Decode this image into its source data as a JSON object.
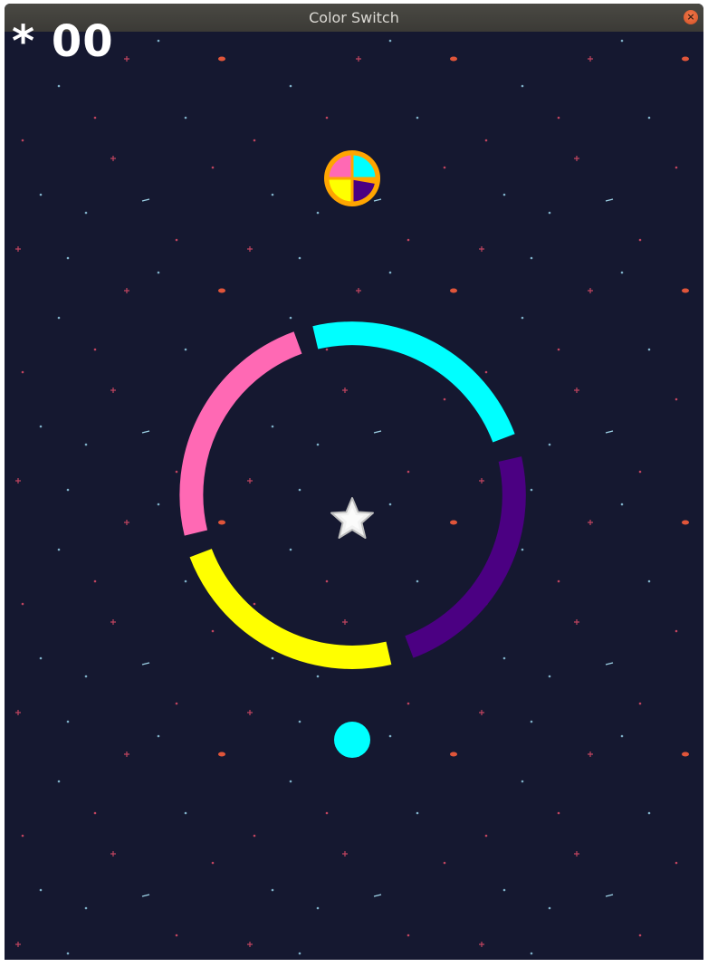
{
  "window": {
    "title": "Color Switch"
  },
  "hud": {
    "score_text": "* 00"
  },
  "colors": {
    "background": "#151830",
    "cyan": "#00ffff",
    "purple": "#4b0082",
    "yellow": "#ffff00",
    "pink": "#ff69b4",
    "switcher_border": "#ffa500",
    "ball": "#00ffff",
    "star": "#ffffff"
  },
  "obstacle": {
    "type": "ring",
    "segments": [
      "cyan",
      "purple",
      "yellow",
      "pink"
    ]
  },
  "player": {
    "color": "cyan"
  },
  "icons": {
    "close": "close-icon",
    "star": "star-icon",
    "switcher": "color-switcher-icon"
  }
}
